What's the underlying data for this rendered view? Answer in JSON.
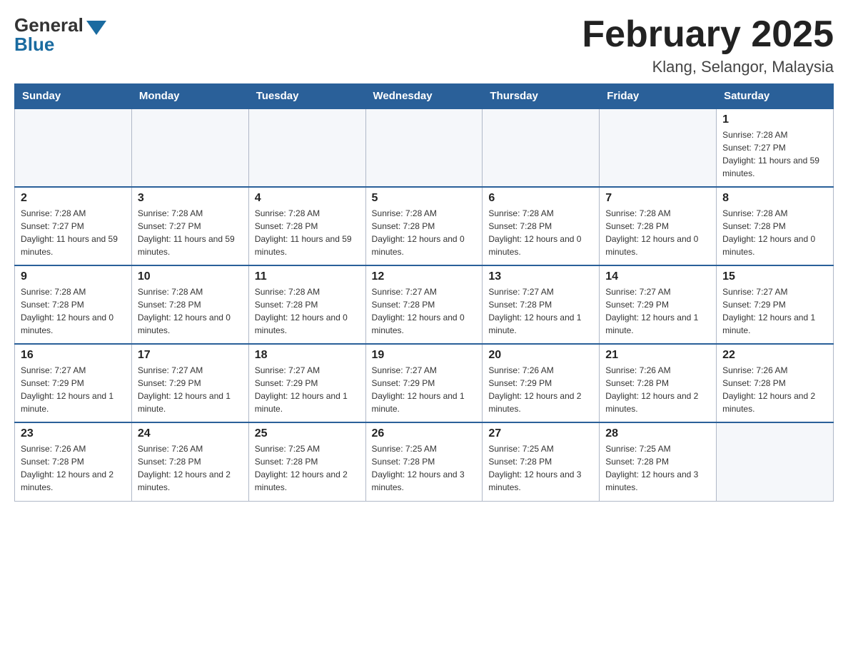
{
  "header": {
    "logo_general": "General",
    "logo_blue": "Blue",
    "month_title": "February 2025",
    "location": "Klang, Selangor, Malaysia"
  },
  "weekdays": [
    "Sunday",
    "Monday",
    "Tuesday",
    "Wednesday",
    "Thursday",
    "Friday",
    "Saturday"
  ],
  "weeks": [
    [
      {
        "day": "",
        "sunrise": "",
        "sunset": "",
        "daylight": "",
        "empty": true
      },
      {
        "day": "",
        "sunrise": "",
        "sunset": "",
        "daylight": "",
        "empty": true
      },
      {
        "day": "",
        "sunrise": "",
        "sunset": "",
        "daylight": "",
        "empty": true
      },
      {
        "day": "",
        "sunrise": "",
        "sunset": "",
        "daylight": "",
        "empty": true
      },
      {
        "day": "",
        "sunrise": "",
        "sunset": "",
        "daylight": "",
        "empty": true
      },
      {
        "day": "",
        "sunrise": "",
        "sunset": "",
        "daylight": "",
        "empty": true
      },
      {
        "day": "1",
        "sunrise": "Sunrise: 7:28 AM",
        "sunset": "Sunset: 7:27 PM",
        "daylight": "Daylight: 11 hours and 59 minutes.",
        "empty": false
      }
    ],
    [
      {
        "day": "2",
        "sunrise": "Sunrise: 7:28 AM",
        "sunset": "Sunset: 7:27 PM",
        "daylight": "Daylight: 11 hours and 59 minutes.",
        "empty": false
      },
      {
        "day": "3",
        "sunrise": "Sunrise: 7:28 AM",
        "sunset": "Sunset: 7:27 PM",
        "daylight": "Daylight: 11 hours and 59 minutes.",
        "empty": false
      },
      {
        "day": "4",
        "sunrise": "Sunrise: 7:28 AM",
        "sunset": "Sunset: 7:28 PM",
        "daylight": "Daylight: 11 hours and 59 minutes.",
        "empty": false
      },
      {
        "day": "5",
        "sunrise": "Sunrise: 7:28 AM",
        "sunset": "Sunset: 7:28 PM",
        "daylight": "Daylight: 12 hours and 0 minutes.",
        "empty": false
      },
      {
        "day": "6",
        "sunrise": "Sunrise: 7:28 AM",
        "sunset": "Sunset: 7:28 PM",
        "daylight": "Daylight: 12 hours and 0 minutes.",
        "empty": false
      },
      {
        "day": "7",
        "sunrise": "Sunrise: 7:28 AM",
        "sunset": "Sunset: 7:28 PM",
        "daylight": "Daylight: 12 hours and 0 minutes.",
        "empty": false
      },
      {
        "day": "8",
        "sunrise": "Sunrise: 7:28 AM",
        "sunset": "Sunset: 7:28 PM",
        "daylight": "Daylight: 12 hours and 0 minutes.",
        "empty": false
      }
    ],
    [
      {
        "day": "9",
        "sunrise": "Sunrise: 7:28 AM",
        "sunset": "Sunset: 7:28 PM",
        "daylight": "Daylight: 12 hours and 0 minutes.",
        "empty": false
      },
      {
        "day": "10",
        "sunrise": "Sunrise: 7:28 AM",
        "sunset": "Sunset: 7:28 PM",
        "daylight": "Daylight: 12 hours and 0 minutes.",
        "empty": false
      },
      {
        "day": "11",
        "sunrise": "Sunrise: 7:28 AM",
        "sunset": "Sunset: 7:28 PM",
        "daylight": "Daylight: 12 hours and 0 minutes.",
        "empty": false
      },
      {
        "day": "12",
        "sunrise": "Sunrise: 7:27 AM",
        "sunset": "Sunset: 7:28 PM",
        "daylight": "Daylight: 12 hours and 0 minutes.",
        "empty": false
      },
      {
        "day": "13",
        "sunrise": "Sunrise: 7:27 AM",
        "sunset": "Sunset: 7:28 PM",
        "daylight": "Daylight: 12 hours and 1 minute.",
        "empty": false
      },
      {
        "day": "14",
        "sunrise": "Sunrise: 7:27 AM",
        "sunset": "Sunset: 7:29 PM",
        "daylight": "Daylight: 12 hours and 1 minute.",
        "empty": false
      },
      {
        "day": "15",
        "sunrise": "Sunrise: 7:27 AM",
        "sunset": "Sunset: 7:29 PM",
        "daylight": "Daylight: 12 hours and 1 minute.",
        "empty": false
      }
    ],
    [
      {
        "day": "16",
        "sunrise": "Sunrise: 7:27 AM",
        "sunset": "Sunset: 7:29 PM",
        "daylight": "Daylight: 12 hours and 1 minute.",
        "empty": false
      },
      {
        "day": "17",
        "sunrise": "Sunrise: 7:27 AM",
        "sunset": "Sunset: 7:29 PM",
        "daylight": "Daylight: 12 hours and 1 minute.",
        "empty": false
      },
      {
        "day": "18",
        "sunrise": "Sunrise: 7:27 AM",
        "sunset": "Sunset: 7:29 PM",
        "daylight": "Daylight: 12 hours and 1 minute.",
        "empty": false
      },
      {
        "day": "19",
        "sunrise": "Sunrise: 7:27 AM",
        "sunset": "Sunset: 7:29 PM",
        "daylight": "Daylight: 12 hours and 1 minute.",
        "empty": false
      },
      {
        "day": "20",
        "sunrise": "Sunrise: 7:26 AM",
        "sunset": "Sunset: 7:29 PM",
        "daylight": "Daylight: 12 hours and 2 minutes.",
        "empty": false
      },
      {
        "day": "21",
        "sunrise": "Sunrise: 7:26 AM",
        "sunset": "Sunset: 7:28 PM",
        "daylight": "Daylight: 12 hours and 2 minutes.",
        "empty": false
      },
      {
        "day": "22",
        "sunrise": "Sunrise: 7:26 AM",
        "sunset": "Sunset: 7:28 PM",
        "daylight": "Daylight: 12 hours and 2 minutes.",
        "empty": false
      }
    ],
    [
      {
        "day": "23",
        "sunrise": "Sunrise: 7:26 AM",
        "sunset": "Sunset: 7:28 PM",
        "daylight": "Daylight: 12 hours and 2 minutes.",
        "empty": false
      },
      {
        "day": "24",
        "sunrise": "Sunrise: 7:26 AM",
        "sunset": "Sunset: 7:28 PM",
        "daylight": "Daylight: 12 hours and 2 minutes.",
        "empty": false
      },
      {
        "day": "25",
        "sunrise": "Sunrise: 7:25 AM",
        "sunset": "Sunset: 7:28 PM",
        "daylight": "Daylight: 12 hours and 2 minutes.",
        "empty": false
      },
      {
        "day": "26",
        "sunrise": "Sunrise: 7:25 AM",
        "sunset": "Sunset: 7:28 PM",
        "daylight": "Daylight: 12 hours and 3 minutes.",
        "empty": false
      },
      {
        "day": "27",
        "sunrise": "Sunrise: 7:25 AM",
        "sunset": "Sunset: 7:28 PM",
        "daylight": "Daylight: 12 hours and 3 minutes.",
        "empty": false
      },
      {
        "day": "28",
        "sunrise": "Sunrise: 7:25 AM",
        "sunset": "Sunset: 7:28 PM",
        "daylight": "Daylight: 12 hours and 3 minutes.",
        "empty": false
      },
      {
        "day": "",
        "sunrise": "",
        "sunset": "",
        "daylight": "",
        "empty": true
      }
    ]
  ]
}
